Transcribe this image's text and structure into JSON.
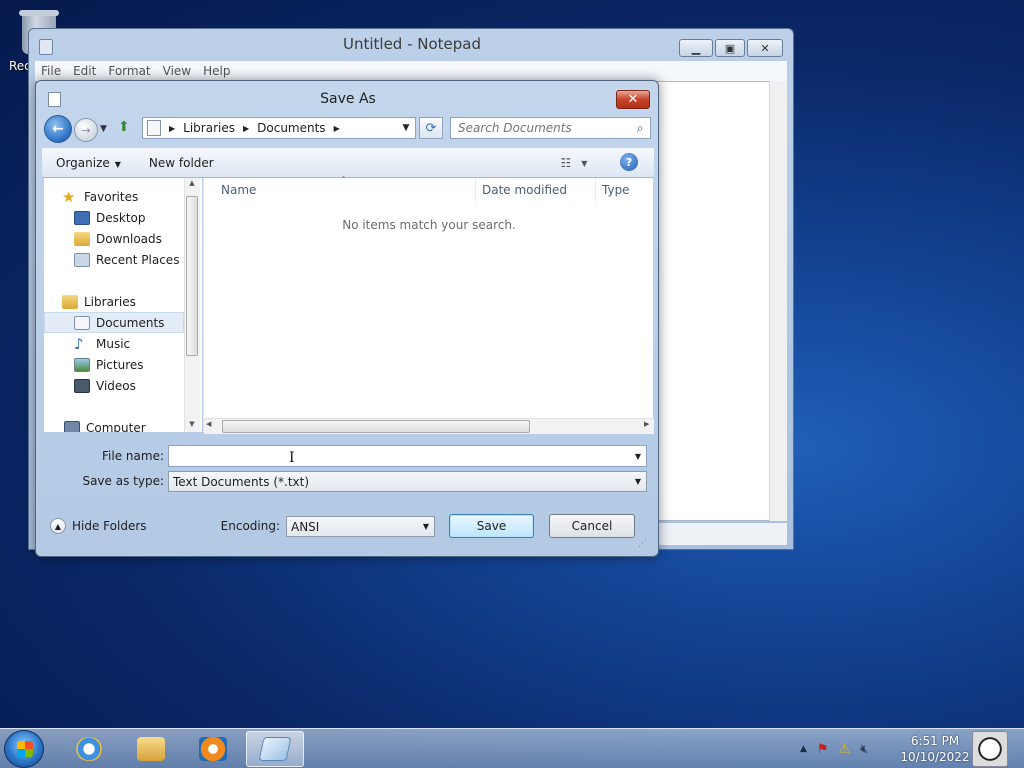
{
  "desktop": {
    "recycle_label": "Rec"
  },
  "notepad": {
    "title": "Untitled - Notepad",
    "menu": [
      "File",
      "Edit",
      "Format",
      "View",
      "Help"
    ]
  },
  "dialog": {
    "title": "Save As",
    "breadcrumb": [
      "Libraries",
      "Documents"
    ],
    "search_placeholder": "Search Documents",
    "toolbar": {
      "organize": "Organize",
      "new_folder": "New folder"
    },
    "nav": {
      "favorites": "Favorites",
      "desktop": "Desktop",
      "downloads": "Downloads",
      "recent": "Recent Places",
      "libraries": "Libraries",
      "documents": "Documents",
      "music": "Music",
      "pictures": "Pictures",
      "videos": "Videos",
      "computer": "Computer"
    },
    "columns": {
      "name": "Name",
      "date": "Date modified",
      "type": "Type"
    },
    "empty_message": "No items match your search.",
    "file_name_label": "File name:",
    "file_name_value": "",
    "save_type_label": "Save as type:",
    "save_type_value": "Text Documents (*.txt)",
    "hide_folders": "Hide Folders",
    "encoding_label": "Encoding:",
    "encoding_value": "ANSI",
    "save": "Save",
    "cancel": "Cancel"
  },
  "taskbar": {
    "time": "6:51 PM",
    "date": "10/10/2022"
  }
}
